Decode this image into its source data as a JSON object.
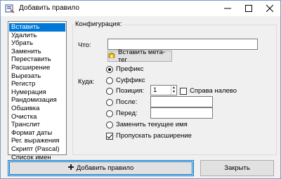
{
  "window": {
    "title": "Добавить правило",
    "minimize_icon": "minimize-icon",
    "maximize_icon": "maximize-icon",
    "close_icon": "close-icon"
  },
  "rules_list": {
    "items": [
      {
        "label": "Вставить",
        "selected": true
      },
      {
        "label": "Удалить",
        "selected": false
      },
      {
        "label": "Убрать",
        "selected": false
      },
      {
        "label": "Заменить",
        "selected": false
      },
      {
        "label": "Переставить",
        "selected": false
      },
      {
        "label": "Расширение",
        "selected": false
      },
      {
        "label": "Вырезать",
        "selected": false
      },
      {
        "label": "Регистр",
        "selected": false
      },
      {
        "label": "Нумерация",
        "selected": false
      },
      {
        "label": "Рандомизация",
        "selected": false
      },
      {
        "label": "Обшивка",
        "selected": false
      },
      {
        "label": "Очистка",
        "selected": false
      },
      {
        "label": "Транслит",
        "selected": false
      },
      {
        "label": "Формат даты",
        "selected": false
      },
      {
        "label": "Рег. выражения",
        "selected": false
      },
      {
        "label": "Скрипт (Pascal)",
        "selected": false
      },
      {
        "label": "Список имен",
        "selected": false
      }
    ]
  },
  "config": {
    "group_label": "Конфигурация:",
    "what_label": "Что:",
    "what_value": "",
    "insert_meta_tag_button": "Вставить мета-тег",
    "where_label": "Куда:",
    "prefix_label": "Префикс",
    "suffix_label": "Суффикс",
    "position_label": "Позиция:",
    "position_value": "1",
    "right_to_left_label": "Справа налево",
    "after_label": "После:",
    "after_value": "",
    "before_label": "Перед:",
    "before_value": "",
    "replace_name_label": "Заменить текущее имя",
    "skip_extension_label": "Пропускать расширение",
    "selected_position": "prefix",
    "right_to_left_checked": false,
    "skip_extension_checked": true
  },
  "footer": {
    "add_rule_button": "Добавить правило",
    "close_button": "Закрыть"
  },
  "colors": {
    "selection": "#0078d7",
    "meta_tag_icon": "#e8b400",
    "add_icon": "#1a1a1a"
  }
}
